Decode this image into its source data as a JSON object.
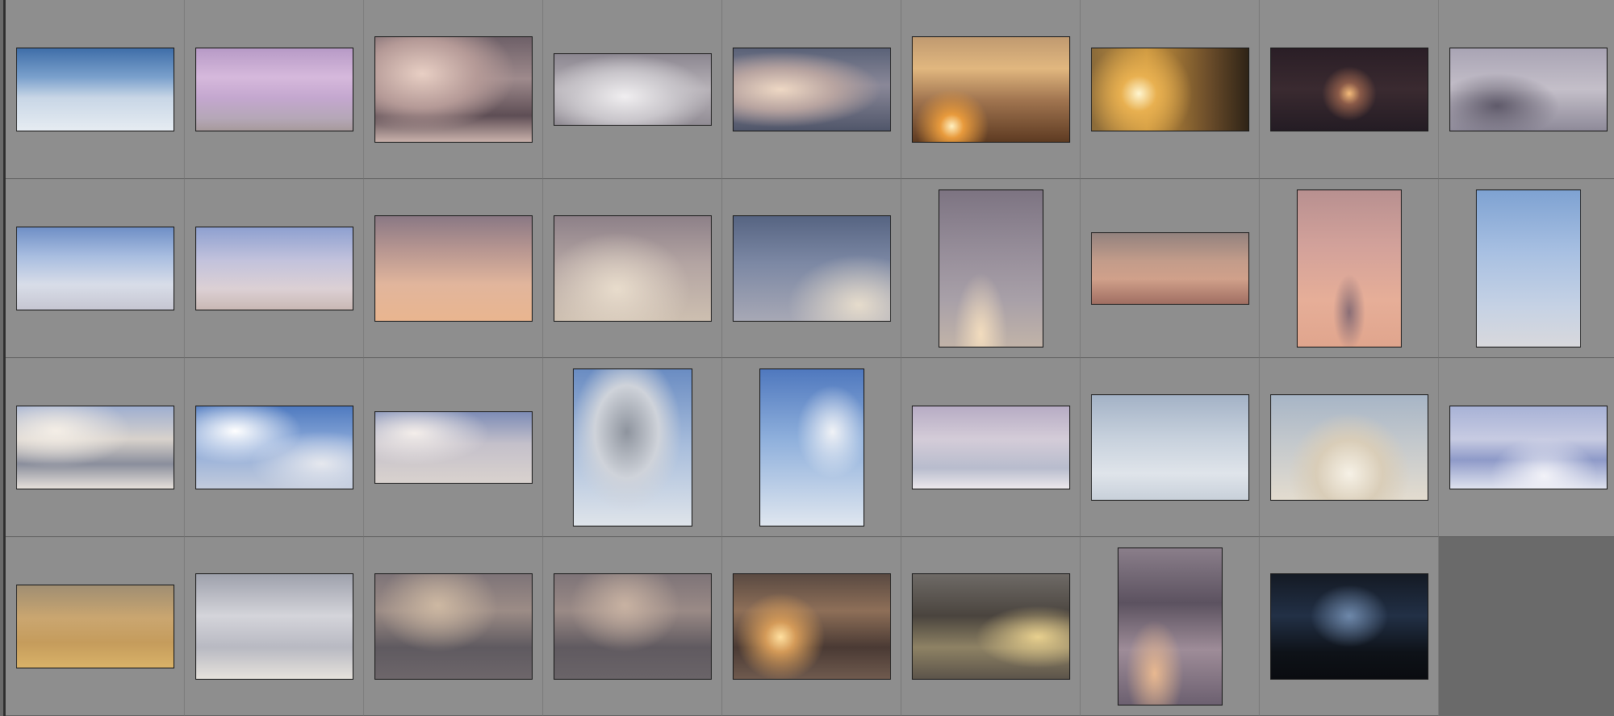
{
  "grid": {
    "rows": 4,
    "columns": 9,
    "thumbnails": [
      {
        "id": "r1c1",
        "shape": "landscape",
        "bg": "linear-gradient(180deg,#3f6ea8 0%,#7aa0cc 35%,#c8d6e6 60%,#e6ecf2 100%)"
      },
      {
        "id": "r1c2",
        "shape": "landscape",
        "bg": "linear-gradient(180deg,#b79ac6 0%,#d6b9dc 35%,#c4a7cf 60%,#b5a7b7 85%,#a79a9c 100%)"
      },
      {
        "id": "r1c3",
        "shape": "landscape-tall",
        "bg": "radial-gradient(ellipse at 30% 35%,#e8cfc4 0%,#b59a97 35%,transparent 60%),linear-gradient(180deg,#6e6068 0%,#9e8a8c 40%,#5e4e55 75%,#c9b1ab 100%)"
      },
      {
        "id": "r1c4",
        "shape": "landscape-short",
        "bg": "radial-gradient(ellipse at 45% 60%,#f0eef0 0%,#c9c6cb 40%,transparent 70%),linear-gradient(180deg,#8b8690 0%,#b7b2b8 50%,#918c94 100%)"
      },
      {
        "id": "r1c5",
        "shape": "landscape",
        "bg": "radial-gradient(ellipse at 30% 50%,#eed8c4 0%,#b8a4a0 35%,transparent 65%),linear-gradient(180deg,#5a6278 0%,#8a8898 45%,#50566a 100%)"
      },
      {
        "id": "r1c6",
        "shape": "landscape-tall",
        "bg": "radial-gradient(circle at 25% 85%,#fff0c0 0%,#e89a3c 8%,transparent 25%),linear-gradient(180deg,#c09a70 0%,#e1b77f 30%,#a17550 60%,#5e3b22 100%)"
      },
      {
        "id": "r1c7",
        "shape": "landscape",
        "bg": "radial-gradient(circle at 30% 55%,#fff6d0 0%,#e8b050 15%,transparent 45%),linear-gradient(90deg,#8a6a3a 0%,#c9953e 35%,#6a4c2a 75%,#2e2316 100%)"
      },
      {
        "id": "r1c8",
        "shape": "landscape",
        "bg": "radial-gradient(circle at 50% 55%,#f4bb7a 0%,#8a5a48 12%,transparent 30%),linear-gradient(180deg,#2a1e26 0%,#3a2a30 50%,#241c24 100%)"
      },
      {
        "id": "r1c9",
        "shape": "landscape",
        "bg": "radial-gradient(ellipse at 30% 70%,#5f5a6a 0%,transparent 40%),linear-gradient(180deg,#a9a4b4 0%,#c4bfc9 50%,#8e8a99 100%)"
      },
      {
        "id": "r2c1",
        "shape": "landscape",
        "bg": "linear-gradient(180deg,#6f8fc6 0%,#a8bde0 35%,#d8dde8 70%,#c6c6d2 100%)"
      },
      {
        "id": "r2c2",
        "shape": "landscape",
        "bg": "linear-gradient(180deg,#8ea0d0 0%,#c2c2dc 40%,#dcd0d4 75%,#c9b8b4 100%)"
      },
      {
        "id": "r2c3",
        "shape": "landscape-tall",
        "bg": "linear-gradient(180deg,#8a7884 0%,#b49490 30%,#e1b59c 65%,#e9b58f 100%)"
      },
      {
        "id": "r2c4",
        "shape": "landscape-tall",
        "bg": "radial-gradient(ellipse at 40% 70%,#e8dccc 0%,transparent 55%),linear-gradient(180deg,#8d8088 0%,#b3a4a2 45%,#cdbfb0 100%)"
      },
      {
        "id": "r2c5",
        "shape": "landscape-tall",
        "bg": "radial-gradient(ellipse at 80% 85%,#e6dccc 0%,transparent 40%),linear-gradient(180deg,#566482 0%,#7c88a4 45%,#a7a8b5 100%)"
      },
      {
        "id": "r2c6",
        "shape": "portrait",
        "bg": "radial-gradient(ellipse at 40% 92%,#f2dcbe 0%,transparent 30%),linear-gradient(180deg,#7d7482 0%,#978e9a 40%,#a8a0a8 70%,#c1b3a8 100%)"
      },
      {
        "id": "r2c7",
        "shape": "landscape-short",
        "bg": "linear-gradient(180deg,#93827e 0%,#c39c8a 40%,#d0a08a 65%,#a06e62 100%)"
      },
      {
        "id": "r2c8",
        "shape": "portrait",
        "bg": "radial-gradient(ellipse at 50% 78%,#8a6e76 0%,transparent 22%),linear-gradient(180deg,#b89090 0%,#d2a19a 35%,#e6ae98 70%,#e0a58d 100%)"
      },
      {
        "id": "r2c9",
        "shape": "portrait",
        "bg": "linear-gradient(180deg,#7ea2d2 0%,#a8c0e2 40%,#c6d2e4 75%,#d8d8dc 100%)"
      },
      {
        "id": "r3c1",
        "shape": "landscape",
        "bg": "radial-gradient(ellipse at 25% 30%,#f4eee6 0%,transparent 45%),linear-gradient(180deg,#9eaed0 0%,#d8d2cc 40%,#8a8e9c 70%,#e6e0da 100%)"
      },
      {
        "id": "r3c2",
        "shape": "landscape",
        "bg": "radial-gradient(ellipse at 25% 30%,#ffffff 0%,transparent 40%),radial-gradient(ellipse at 80% 70%,#e6e8ee 0%,transparent 40%),linear-gradient(180deg,#4f7ac0 0%,#8aa8d8 45%,#c2cbdc 100%)"
      },
      {
        "id": "r3c3",
        "shape": "landscape-short",
        "bg": "radial-gradient(ellipse at 25% 30%,#f4eeea 0%,transparent 45%),linear-gradient(180deg,#7d8cb6 0%,#c4c0ca 45%,#d9d2ce 100%)"
      },
      {
        "id": "r3c4",
        "shape": "portrait-wide",
        "bg": "radial-gradient(ellipse at 45% 40%,#8e949e 0%,#cfd3da 35%,transparent 60%),linear-gradient(180deg,#6a8cc2 0%,#a9bedc 50%,#dfe4ea 100%)"
      },
      {
        "id": "r3c5",
        "shape": "portrait",
        "bg": "radial-gradient(ellipse at 70% 40%,#f0f2f6 0%,transparent 35%),linear-gradient(180deg,#4f78be 0%,#8fb0dc 45%,#dfe6ef 100%)"
      },
      {
        "id": "r3c6",
        "shape": "landscape",
        "bg": "linear-gradient(180deg,#b7acc4 0%,#d4ccd8 40%,#b8bccd 75%,#ece8ec 100%)"
      },
      {
        "id": "r3c7",
        "shape": "landscape-tall",
        "bg": "linear-gradient(180deg,#a3b2c6 0%,#c6d0dc 40%,#dfe4ea 75%,#c8d0da 100%)"
      },
      {
        "id": "r3c8",
        "shape": "landscape-tall",
        "bg": "radial-gradient(ellipse at 50% 75%,#f6f1e6 0%,#d9cdb8 30%,transparent 55%),linear-gradient(180deg,#a7b5c6 0%,#c3c8cc 45%,#e3dccf 100%)"
      },
      {
        "id": "r3c9",
        "shape": "landscape",
        "bg": "radial-gradient(ellipse at 60% 85%,#f2f2f8 0%,transparent 40%),linear-gradient(180deg,#a8b2d6 0%,#c7cbe2 40%,#8e9ac8 65%,#dfe2ee 100%)"
      },
      {
        "id": "r4c1",
        "shape": "landscape",
        "bg": "linear-gradient(180deg,#a08e72 0%,#caa670 40%,#c59c5c 70%,#d9b268 100%)"
      },
      {
        "id": "r4c2",
        "shape": "landscape-tall",
        "bg": "linear-gradient(180deg,#9ea1ac 0%,#d4d4da 40%,#b8b9c2 70%,#e6e2dc 100%)"
      },
      {
        "id": "r4c3",
        "shape": "landscape-tall",
        "bg": "radial-gradient(ellipse at 40% 30%,#cdb8a2 0%,transparent 45%),linear-gradient(180deg,#7e7478 0%,#9c8c86 35%,#5f5a60 70%,#6d666a 100%)"
      },
      {
        "id": "r4c4",
        "shape": "landscape-tall",
        "bg": "radial-gradient(ellipse at 45% 30%,#c8b2a2 0%,transparent 45%),linear-gradient(180deg,#7e7478 0%,#9a8a86 35%,#605a60 70%,#6a6468 100%)"
      },
      {
        "id": "r4c5",
        "shape": "landscape-tall",
        "bg": "radial-gradient(circle at 30% 60%,#ffe0a0 0%,#d49a58 12%,transparent 35%),linear-gradient(180deg,#5a4a42 0%,#8e6f58 35%,#4a3a34 70%,#6f5a4e 100%)"
      },
      {
        "id": "r4c6",
        "shape": "landscape-tall",
        "bg": "radial-gradient(ellipse at 80% 60%,#e8d08e 0%,transparent 35%),linear-gradient(180deg,#6e6a66 0%,#4a443e 40%,#8e8264 70%,#5c544a 100%)"
      },
      {
        "id": "r4c7",
        "shape": "portrait",
        "bg": "radial-gradient(ellipse at 35% 80%,#e8b890 0%,transparent 30%),linear-gradient(180deg,#8a7e8a 0%,#5c5260 35%,#9e8c98 65%,#6c6070 100%)"
      },
      {
        "id": "r4c8",
        "shape": "landscape-tall",
        "bg": "radial-gradient(ellipse at 50% 40%,#6e88aa 0%,transparent 35%),linear-gradient(180deg,#141a24 0%,#223046 40%,#0e1218 75%,#0a0c10 100%)"
      },
      {
        "id": "r4c9",
        "shape": "none",
        "bg": ""
      }
    ]
  }
}
